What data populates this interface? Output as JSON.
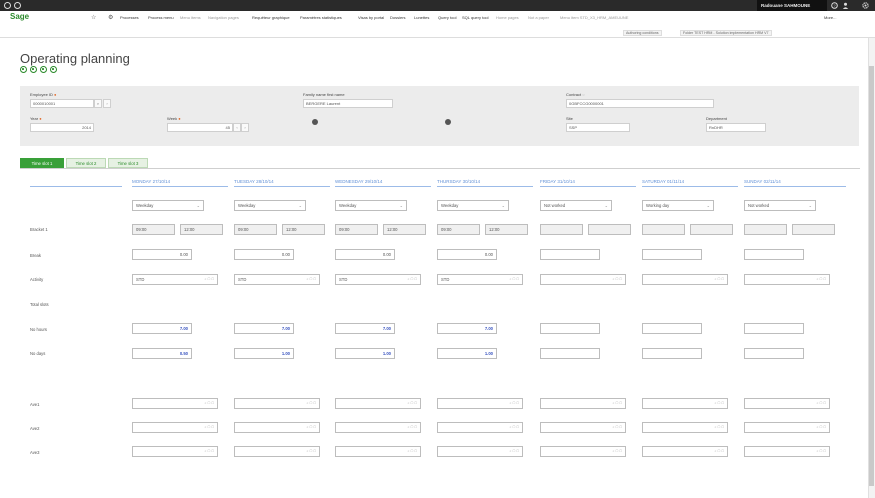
{
  "topbar": {
    "user_name": "Radouane SAHMOUNE",
    "icons": [
      "circle-icon",
      "circle-icon",
      "help-icon",
      "user-icon",
      "settings-icon"
    ]
  },
  "nav": {
    "logo": "Sage",
    "items": [
      "Processes",
      "Process menu",
      "Menu items",
      "Navigation pages",
      "Requêteur graphique",
      "Paramètres statistiques",
      "Visas by portal",
      "Dossiers",
      "Lunettes",
      "Query tool",
      "SQL query tool",
      "Home pages",
      "Not a paper",
      "Menu item STD_X3_HRM_AMEUUNE",
      "More..."
    ],
    "light_items": [
      false,
      false,
      true,
      true,
      false,
      false,
      false,
      false,
      false,
      false,
      false,
      true,
      true,
      true,
      false
    ],
    "sub_buttons": [
      "Authoring conditions",
      "Folder TEST HRM - Solution implementation HRM V7"
    ]
  },
  "page": {
    "title": "Operating planning",
    "action_icons": [
      "action-icon-1",
      "action-icon-2",
      "action-icon-3",
      "action-icon-4"
    ]
  },
  "header": {
    "employee_id_label": "Employee ID",
    "employee_id_value": "0000010001",
    "family_name_label": "Family name first name",
    "family_name_value": "BERGERE Laurent",
    "contract_label": "Contract",
    "contract_value": "0GBFCCG0000001",
    "year_label": "Year",
    "year_value": "2014",
    "week_label": "Week",
    "week_value": "45",
    "site_label": "Site",
    "site_value": "SSP",
    "department_label": "Department",
    "department_value": "RnDHR"
  },
  "tabs": [
    "Time slot 1",
    "Time slot 2",
    "Time slot 3"
  ],
  "days": [
    {
      "label": "MONDAY 27/10/14",
      "type": "Weekday",
      "start": "09:00",
      "end": "12:00",
      "break": "0.00",
      "activity": "STD",
      "hours": "7.00",
      "days": "0.50"
    },
    {
      "label": "TUESDAY 28/10/14",
      "type": "Weekday",
      "start": "09:00",
      "end": "12:00",
      "break": "0.00",
      "activity": "STD",
      "hours": "7.00",
      "days": "1.00"
    },
    {
      "label": "WEDNESDAY 29/10/14",
      "type": "Weekday",
      "start": "09:00",
      "end": "12:00",
      "break": "0.00",
      "activity": "STD",
      "hours": "7.00",
      "days": "1.00"
    },
    {
      "label": "THURSDAY 30/10/14",
      "type": "Weekday",
      "start": "09:00",
      "end": "12:00",
      "break": "0.00",
      "activity": "STD",
      "hours": "7.00",
      "days": "1.00"
    },
    {
      "label": "FRIDAY 31/10/14",
      "type": "Not worked",
      "start": "",
      "end": "",
      "break": "",
      "activity": "",
      "hours": "",
      "days": ""
    },
    {
      "label": "SATURDAY 01/11/14",
      "type": "Working day",
      "start": "",
      "end": "",
      "break": "",
      "activity": "",
      "hours": "",
      "days": ""
    },
    {
      "label": "SUNDAY 02/11/14",
      "type": "Not worked",
      "start": "",
      "end": "",
      "break": "",
      "activity": "",
      "hours": "",
      "days": ""
    }
  ],
  "rows": {
    "bracket": "Bracket 1",
    "break": "Break",
    "activity": "Activity",
    "total_slots": "Total slots",
    "no_hours": "No hours",
    "no_days": "No days",
    "ave1": "Ave1",
    "ave2": "Ave2",
    "ave3": "Ave3"
  }
}
